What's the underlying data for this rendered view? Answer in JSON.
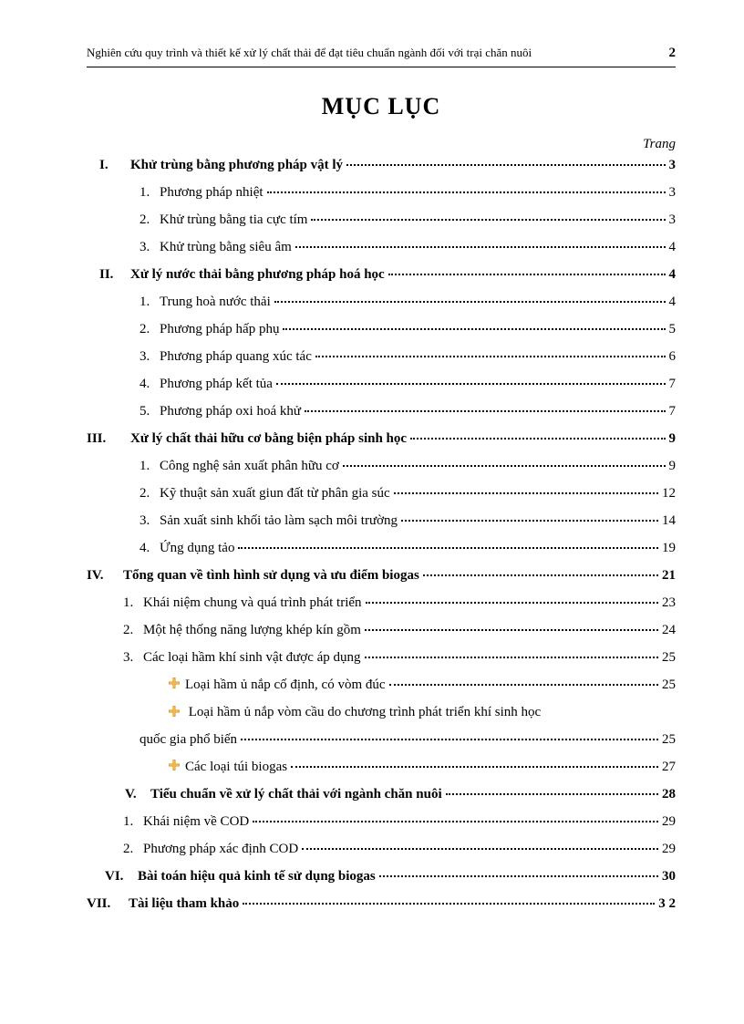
{
  "header": {
    "text": "Nghiên cứu quy trình và thiết kế xử lý chất thải để đạt tiêu chuẩn ngành đối với trại chăn nuôi",
    "page": "2"
  },
  "title": "MỤC LỤC",
  "page_label": "Trang",
  "s1": {
    "num": "I.",
    "title": "Khử trùng bằng phương pháp vật lý",
    "page": "3",
    "i1n": "1.",
    "i1t": "Phương pháp nhiệt",
    "i1p": "3",
    "i2n": "2.",
    "i2t": "Khử trùng bằng tia cực tím",
    "i2p": "3",
    "i3n": "3.",
    "i3t": "Khử trùng bằng siêu âm",
    "i3p": "4"
  },
  "s2": {
    "num": "II.",
    "title": "Xử lý nước thải bằng phương pháp hoá học",
    "page": "4",
    "i1n": "1.",
    "i1t": "Trung hoà nước thải",
    "i1p": "4",
    "i2n": "2.",
    "i2t": "Phương pháp hấp phụ",
    "i2p": "5",
    "i3n": "3.",
    "i3t": "Phương pháp quang xúc tác",
    "i3p": "6",
    "i4n": "4.",
    "i4t": "Phương pháp kết tủa",
    "i4p": "7",
    "i5n": "5.",
    "i5t": "Phương pháp oxi hoá khử",
    "i5p": "7"
  },
  "s3": {
    "num": "III.",
    "title": "Xử lý chất thải hữu cơ bằng biện pháp sinh học",
    "page": "9",
    "i1n": "1.",
    "i1t": "Công nghệ sản xuất phân hữu cơ",
    "i1p": "9",
    "i2n": "2.",
    "i2t": "Kỹ thuật sản xuất giun đất từ phân gia súc",
    "i2p": "12",
    "i3n": "3.",
    "i3t": "Sản xuất sinh khối tảo làm sạch môi trường",
    "i3p": "14",
    "i4n": "4.",
    "i4t": "Ứng dụng tảo",
    "i4p": "19"
  },
  "s4": {
    "num": "IV.",
    "title": "Tổng quan về tình hình sử dụng và ưu điểm biogas",
    "page": "21",
    "i1n": "1.",
    "i1t": "Khái niệm chung và quá trình phát triển",
    "i1p": "23",
    "i2n": "2.",
    "i2t": "Một hệ thống năng lượng khép kín gồm",
    "i2p": "24",
    "i3n": "3.",
    "i3t": "Các loại hầm khí sinh vật được áp dụng",
    "i3p": "25",
    "b1t": "Loại hầm ủ nắp cố định, có vòm đúc",
    "b1p": "25",
    "b2t": "Loại hầm ủ nắp vòm cầu do chương trình phát triển khí sinh học",
    "b2cont": "quốc gia phổ biến",
    "b2p": "25",
    "b3t": "Các loại túi biogas",
    "b3p": "27"
  },
  "s5": {
    "num": "V.",
    "title": "Tiểu chuẩn về xử lý chất thải với ngành chăn nuôi",
    "page": "28",
    "i1n": "1.",
    "i1t": "Khái niệm về COD",
    "i1p": "29",
    "i2n": "2.",
    "i2t": "Phương pháp xác định COD",
    "i2p": "29"
  },
  "s6": {
    "num": "VI.",
    "title": "Bài toán hiệu quả kinh tế sử dụng biogas",
    "page": "30"
  },
  "s7": {
    "num": "VII.",
    "title": "Tài liệu tham khảo",
    "page": " 3 2"
  }
}
